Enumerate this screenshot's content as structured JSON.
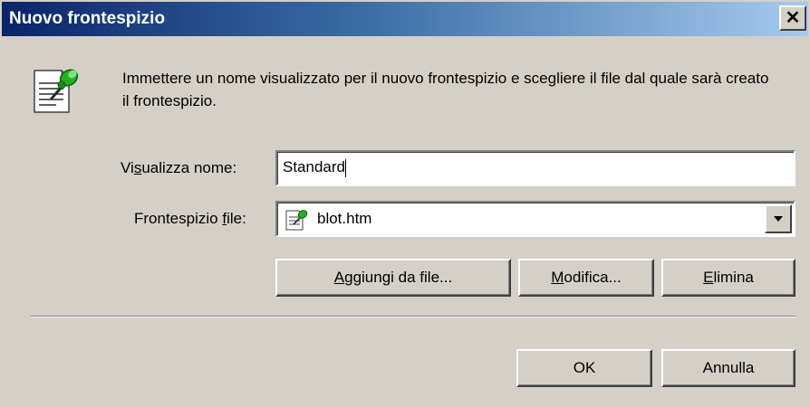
{
  "window": {
    "title": "Nuovo frontespizio",
    "close_glyph": "✕"
  },
  "description": "Immettere un nome visualizzato per il nuovo frontespizio e scegliere il file dal quale sarà creato il frontespizio.",
  "display_name": {
    "label_pre": "Vi",
    "label_accel": "s",
    "label_post": "ualizza nome:",
    "value": "Standard"
  },
  "cover_file": {
    "label_pre": "Frontespizio ",
    "label_accel": "f",
    "label_post": "ile:",
    "selected": "blot.htm",
    "icon": "cover-page-file-icon"
  },
  "buttons": {
    "add_accel": "A",
    "add_rest": "ggiungi da file...",
    "edit_accel": "M",
    "edit_rest": "odifica...",
    "delete_accel": "E",
    "delete_rest": "limina",
    "ok": "OK",
    "cancel": "Annulla"
  },
  "colors": {
    "titlebar_start": "#0a246a",
    "titlebar_end": "#a6caf0",
    "dialog_face": "#d4d0c8"
  }
}
